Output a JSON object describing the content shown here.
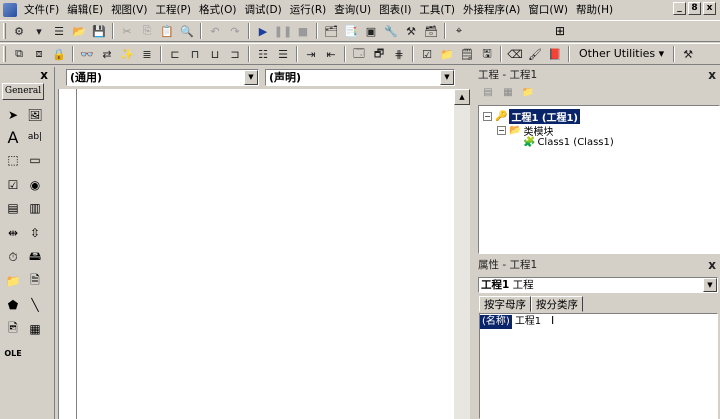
{
  "menu": {
    "items": [
      "文件(F)",
      "编辑(E)",
      "视图(V)",
      "工程(P)",
      "格式(O)",
      "调试(D)",
      "运行(R)",
      "查询(U)",
      "图表(I)",
      "工具(T)",
      "外接程序(A)",
      "窗口(W)",
      "帮助(H)"
    ],
    "window_controls": [
      "_",
      "8",
      "x"
    ]
  },
  "toolbar": {
    "other_utilities": "Other Utilities ▾"
  },
  "toolbox": {
    "tab_label": "General",
    "close": "x"
  },
  "code_window": {
    "object_combo": "(通用)",
    "proc_combo": "(声明)"
  },
  "project_panel": {
    "title": "工程 - 工程1",
    "close": "x",
    "tree": {
      "root_label": "工程1 (工程1)",
      "folder_label": "类模块",
      "class_label": "Class1 (Class1)"
    }
  },
  "properties_panel": {
    "title": "属性 - 工程1",
    "close": "x",
    "object_name": "工程1",
    "object_type": " 工程",
    "tabs": [
      "按字母序",
      "按分类序"
    ],
    "rows": [
      {
        "name": "(名称)",
        "value": "工程1"
      }
    ]
  },
  "colors": {
    "chrome": "#d4d0c8",
    "selection": "#0a246a"
  }
}
